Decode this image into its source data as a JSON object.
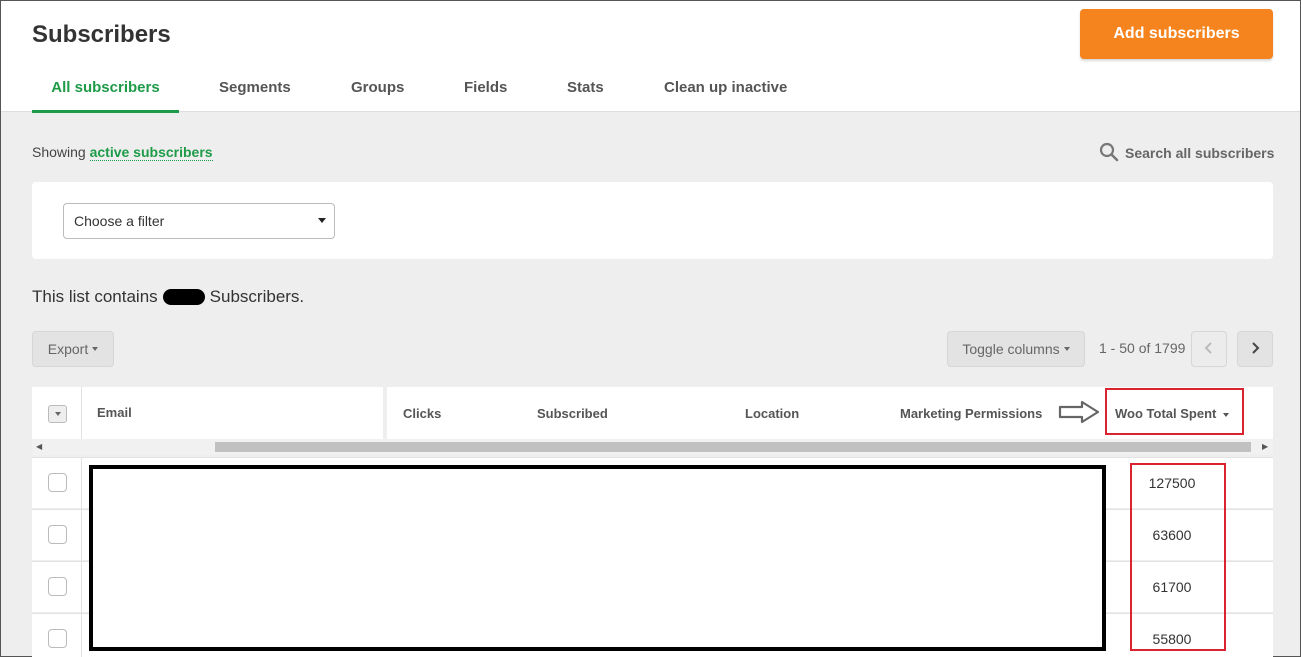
{
  "header": {
    "title": "Subscribers",
    "add_button": "Add subscribers",
    "add_button_color": "#f5841f",
    "tabs": [
      {
        "label": "All subscribers",
        "active": true
      },
      {
        "label": "Segments",
        "active": false
      },
      {
        "label": "Groups",
        "active": false
      },
      {
        "label": "Fields",
        "active": false
      },
      {
        "label": "Stats",
        "active": false
      },
      {
        "label": "Clean up inactive",
        "active": false
      }
    ],
    "accent_color": "#1e9b48"
  },
  "toolbar": {
    "showing_prefix": "Showing",
    "showing_link": "active subscribers",
    "search_label": "Search all subscribers",
    "search_icon": "search-icon"
  },
  "filter": {
    "placeholder": "Choose a filter"
  },
  "summary": {
    "prefix": "This list contains",
    "suffix": "Subscribers."
  },
  "actions": {
    "export_label": "Export",
    "toggle_columns_label": "Toggle columns",
    "pagination": "1 - 50 of 1799",
    "prev_icon": "chevron-left-icon",
    "next_icon": "chevron-right-icon"
  },
  "table": {
    "columns": [
      "Email",
      "Clicks",
      "Subscribed",
      "Location",
      "Marketing Permissions",
      "Woo Total Spent"
    ],
    "rows": [
      {
        "woo_total_spent": "127500"
      },
      {
        "woo_total_spent": "63600"
      },
      {
        "woo_total_spent": "61700"
      },
      {
        "woo_total_spent": "55800"
      }
    ]
  },
  "annotations": {
    "highlight_color": "#d9232e",
    "arrow_icon": "arrow-right-outline-icon"
  }
}
